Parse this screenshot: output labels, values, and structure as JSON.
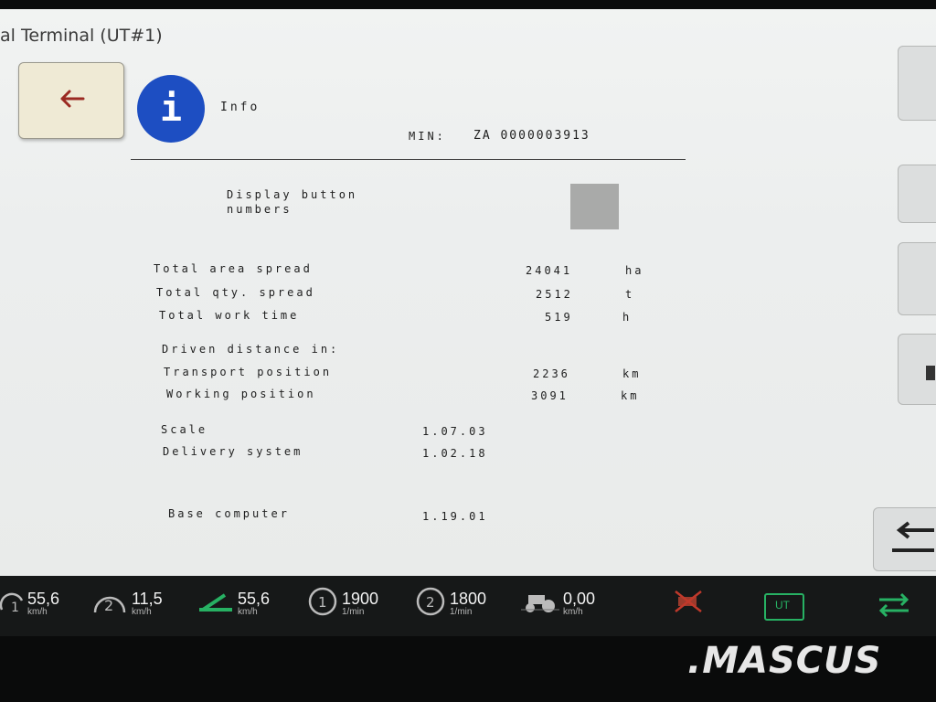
{
  "window": {
    "title": "al Terminal (UT#1)"
  },
  "header": {
    "info_icon_glyph": "i",
    "title": "Info",
    "min_label": "MIN:",
    "min_value": "ZA 0000003913"
  },
  "settings": {
    "display_button_numbers_line1": "Display button",
    "display_button_numbers_line2": "numbers"
  },
  "totals": [
    {
      "label": "Total area spread",
      "value": "24041",
      "unit": "ha"
    },
    {
      "label": "Total qty. spread",
      "value": "2512",
      "unit": "t"
    },
    {
      "label": "Total work time",
      "value": "519",
      "unit": "h"
    }
  ],
  "distance": {
    "heading": "Driven distance in:",
    "rows": [
      {
        "label": "Transport position",
        "value": "2236",
        "unit": "km"
      },
      {
        "label": "Working position",
        "value": "3091",
        "unit": "km"
      }
    ]
  },
  "versions": [
    {
      "label": "Scale",
      "value": "1.07.03"
    },
    {
      "label": "Delivery system",
      "value": "1.02.18"
    },
    {
      "label": "Base computer",
      "value": "1.19.01"
    }
  ],
  "statusbar": {
    "speed1": {
      "value": "55,6",
      "unit": "km/h"
    },
    "speed2": {
      "value": "11,5",
      "unit": "km/h"
    },
    "speed3": {
      "value": "55,6",
      "unit": "km/h"
    },
    "pto1": {
      "value": "1900",
      "unit": "1/min"
    },
    "pto2": {
      "value": "1800",
      "unit": "1/min"
    },
    "speed4": {
      "value": "0,00",
      "unit": "km/h"
    },
    "ut_label": "UT"
  },
  "watermark": ".MASCUS",
  "colors": {
    "info_blue": "#1d4ec2",
    "back_arrow": "#9b2a22",
    "status_green": "#27b163",
    "status_red": "#c0392b"
  }
}
